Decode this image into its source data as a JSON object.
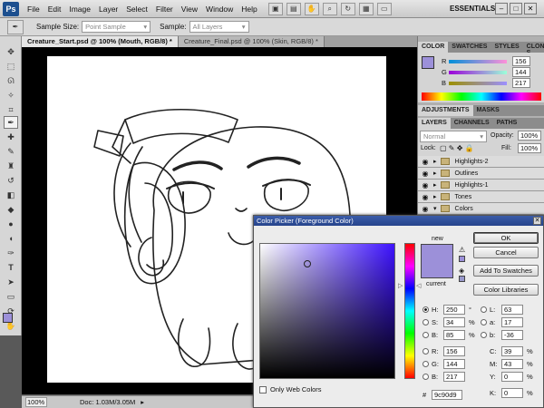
{
  "app": {
    "logo": "Ps",
    "workspace": "ESSENTIALS"
  },
  "menu": [
    "File",
    "Edit",
    "Image",
    "Layer",
    "Select",
    "Filter",
    "View",
    "Window",
    "Help"
  ],
  "window_controls": [
    "–",
    "□",
    "✕"
  ],
  "options_bar": {
    "sample_size_label": "Sample Size:",
    "sample_size_value": "Point Sample",
    "sample_label": "Sample:",
    "sample_value": "All Layers"
  },
  "tabs": [
    {
      "label": "Creature_Start.psd @ 100% (Mouth, RGB/8) *"
    },
    {
      "label": "Creature_Final.psd @ 100% (Skin, RGB/8) *"
    }
  ],
  "status": {
    "zoom": "100%",
    "doc": "Doc: 1.03M/3.05M"
  },
  "color_panel": {
    "tabs": [
      "COLOR",
      "SWATCHES",
      "STYLES",
      "CLONE S"
    ],
    "channels": [
      {
        "label": "R",
        "value": "156"
      },
      {
        "label": "G",
        "value": "144"
      },
      {
        "label": "B",
        "value": "217"
      }
    ]
  },
  "adjustments_panel": {
    "tabs": [
      "ADJUSTMENTS",
      "MASKS"
    ]
  },
  "layers_panel": {
    "tabs": [
      "LAYERS",
      "CHANNELS",
      "PATHS"
    ],
    "blend_mode": "Normal",
    "opacity_label": "Opacity:",
    "opacity_value": "100%",
    "lock_label": "Lock:",
    "fill_label": "Fill:",
    "fill_value": "100%",
    "layers": [
      "Highlights-2",
      "Outlines",
      "Highlights-1",
      "Tones",
      "Colors"
    ]
  },
  "color_picker": {
    "title": "Color Picker (Foreground Color)",
    "new_label": "new",
    "current_label": "current",
    "buttons": {
      "ok": "OK",
      "cancel": "Cancel",
      "add_swatches": "Add To Swatches",
      "libraries": "Color Libraries"
    },
    "only_web_colors": "Only Web Colors",
    "hsb": [
      {
        "label": "H:",
        "value": "250",
        "unit": "°",
        "selected": true
      },
      {
        "label": "S:",
        "value": "34",
        "unit": "%",
        "selected": false
      },
      {
        "label": "B:",
        "value": "85",
        "unit": "%",
        "selected": false
      }
    ],
    "rgb": [
      {
        "label": "R:",
        "value": "156"
      },
      {
        "label": "G:",
        "value": "144"
      },
      {
        "label": "B:",
        "value": "217"
      }
    ],
    "lab": [
      {
        "label": "L:",
        "value": "63"
      },
      {
        "label": "a:",
        "value": "17"
      },
      {
        "label": "b:",
        "value": "-36"
      }
    ],
    "cmyk": [
      {
        "label": "C:",
        "value": "39",
        "unit": "%"
      },
      {
        "label": "M:",
        "value": "43",
        "unit": "%"
      },
      {
        "label": "Y:",
        "value": "0",
        "unit": "%"
      },
      {
        "label": "K:",
        "value": "0",
        "unit": "%"
      }
    ],
    "hex_label": "#",
    "hex": "9c90d9"
  },
  "colors": {
    "foreground": "#9c90d9",
    "hue": "#3d12ff",
    "current": "#9c90d9"
  }
}
